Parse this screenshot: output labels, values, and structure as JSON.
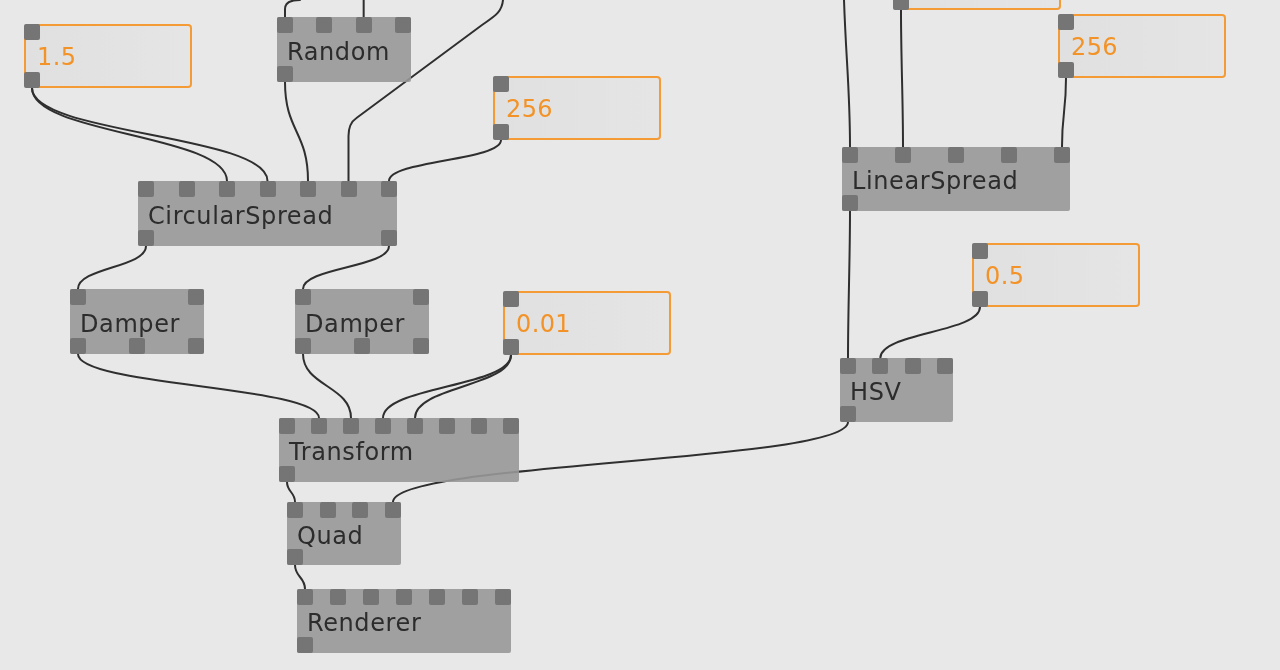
{
  "patch": {
    "nodes": [
      {
        "kind": "iobox"
      },
      {
        "kind": "node",
        "label": "Random"
      },
      {
        "kind": "iobox",
        "value": "256"
      },
      {
        "kind": "iobox",
        "value": "1.5"
      },
      {
        "kind": "iobox",
        "value": "256"
      },
      {
        "kind": "node",
        "label": "LinearSpread"
      },
      {
        "kind": "node",
        "label": "CircularSpread"
      },
      {
        "kind": "iobox",
        "value": "0.5"
      },
      {
        "kind": "node",
        "label": "Damper"
      },
      {
        "kind": "node",
        "label": "Damper"
      },
      {
        "kind": "iobox",
        "value": "0.01"
      },
      {
        "kind": "node",
        "label": "HSV"
      },
      {
        "kind": "node",
        "label": "Transform"
      },
      {
        "kind": "node",
        "label": "Quad"
      },
      {
        "kind": "node",
        "label": "Renderer"
      }
    ]
  }
}
